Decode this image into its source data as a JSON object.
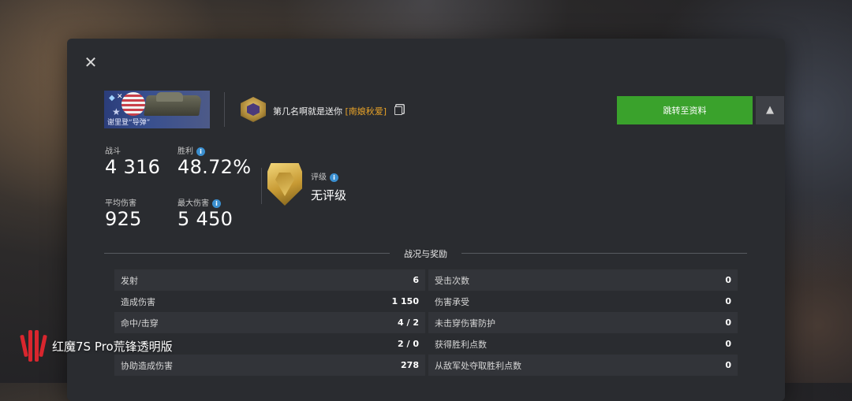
{
  "colors": {
    "accent_green": "#3aa22c",
    "clan_orange": "#e7a228",
    "info_blue": "#3a8fd0",
    "panel_bg": "#2a2c30"
  },
  "icons": {
    "close": "close-icon",
    "copy": "copy-icon",
    "report": "warning-icon",
    "info": "info-icon"
  },
  "header": {
    "clan_banner_text": "谢里登“导弹”",
    "player_name": "第几名啊就是送你",
    "clan_name": "[南娘秋爱]",
    "profile_button": "跳转至资料",
    "report_symbol": "▲"
  },
  "stats": {
    "battles_label": "战斗",
    "battles_value": "4 316",
    "wins_label": "胜利",
    "wins_value": "48.72%",
    "avg_damage_label": "平均伤害",
    "avg_damage_value": "925",
    "max_damage_label": "最大伤害",
    "max_damage_value": "5 450",
    "rating_label": "评级",
    "rating_value": "无评级"
  },
  "section_title": "战况与奖励",
  "table_left": [
    {
      "label": "发射",
      "value": "6"
    },
    {
      "label": "造成伤害",
      "value": "1 150"
    },
    {
      "label": "命中/击穿",
      "value": "4 / 2"
    },
    {
      "label": "",
      "value": "2 / 0"
    },
    {
      "label": "协助造成伤害",
      "value": "278"
    }
  ],
  "table_right": [
    {
      "label": "受击次数",
      "value": "0"
    },
    {
      "label": "伤害承受",
      "value": "0"
    },
    {
      "label": "未击穿伤害防护",
      "value": "0"
    },
    {
      "label": "获得胜利点数",
      "value": "0"
    },
    {
      "label": "从敌军处夺取胜利点数",
      "value": "0"
    }
  ],
  "watermark": "红魔7S Pro荒锋透明版"
}
